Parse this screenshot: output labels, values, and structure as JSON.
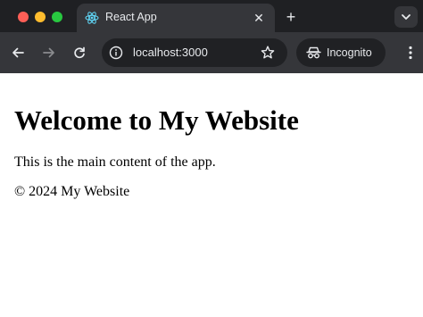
{
  "browser": {
    "tab": {
      "title": "React App",
      "favicon": "react-logo-icon"
    },
    "address_bar": {
      "url": "localhost:3000"
    },
    "profile": {
      "label": "Incognito"
    },
    "icons": {
      "back": "arrow-left-icon",
      "forward": "arrow-right-icon",
      "reload": "reload-icon",
      "site_info": "site-info-icon",
      "bookmark": "star-icon",
      "new_tab": "plus-icon",
      "close_tab": "close-icon",
      "tab_search": "chevron-down-icon"
    },
    "colors": {
      "tab_strip": "#1f2023",
      "toolbar": "#35363a",
      "omnibox": "#202124",
      "react_blue": "#61dafb"
    }
  },
  "page": {
    "heading": "Welcome to My Website",
    "body_text": "This is the main content of the app.",
    "footer_text": "© 2024 My Website"
  }
}
